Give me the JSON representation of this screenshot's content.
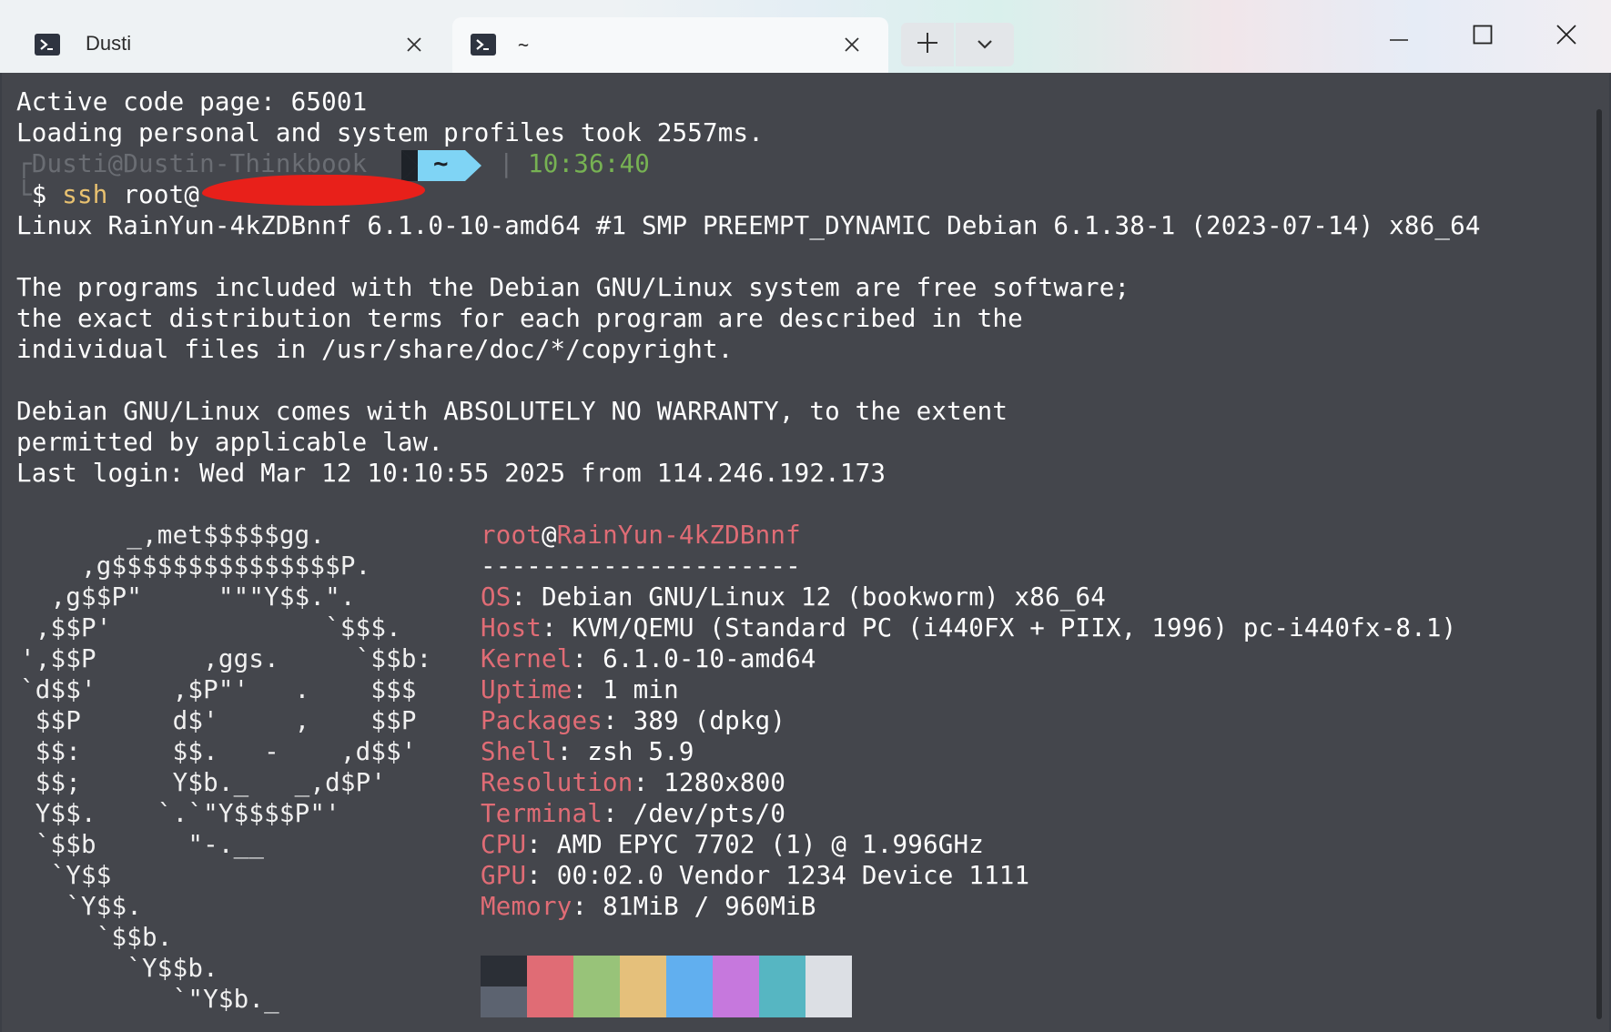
{
  "window": {
    "tabs": [
      {
        "label": "Dusti",
        "icon": "powershell-icon"
      },
      {
        "label": "~",
        "icon": "powershell-icon"
      }
    ],
    "new_tab_icon": "plus-icon",
    "dropdown_icon": "chevron-down-icon",
    "controls": [
      "minimize-icon",
      "maximize-icon",
      "close-icon"
    ]
  },
  "terminal": {
    "line1": "Active code page: 65001",
    "line2": "Loading personal and system profiles took 2557ms.",
    "prompt": {
      "user_host": "Dusti@Dustin-Thinkbook",
      "dir": "~",
      "separator": "|",
      "time": "10:36:40",
      "dollar": "$",
      "cmd": "ssh",
      "arg": "root@"
    },
    "motd": [
      "Linux RainYun-4kZDBnnf 6.1.0-10-amd64 #1 SMP PREEMPT_DYNAMIC Debian 6.1.38-1 (2023-07-14) x86_64",
      "",
      "The programs included with the Debian GNU/Linux system are free software;",
      "the exact distribution terms for each program are described in the",
      "individual files in /usr/share/doc/*/copyright.",
      "",
      "Debian GNU/Linux comes with ABSOLUTELY NO WARRANTY, to the extent",
      "permitted by applicable law.",
      "Last login: Wed Mar 12 10:10:55 2025 from 114.246.192.173"
    ],
    "logo": [
      "       _,met$$$$$gg.",
      "    ,g$$$$$$$$$$$$$$$P.",
      "  ,g$$P\"     \"\"\"Y$$.\".",
      " ,$$P'              `$$$.",
      "',$$P       ,ggs.     `$$b:",
      "`d$$'     ,$P\"'   .    $$$",
      " $$P      d$'     ,    $$P",
      " $$:      $$.   -    ,d$$'",
      " $$;      Y$b._   _,d$P'",
      " Y$$.    `.`\"Y$$$$P\"'",
      " `$$b      \"-.__",
      "  `Y$$",
      "   `Y$$.",
      "     `$$b.",
      "       `Y$$b.",
      "          `\"Y$b._"
    ],
    "fetch": {
      "user": "root",
      "at": "@",
      "host": "RainYun-4kZDBnnf",
      "rule": "---------------------",
      "rows": [
        {
          "key": "OS",
          "value": "Debian GNU/Linux 12 (bookworm) x86_64"
        },
        {
          "key": "Host",
          "value": "KVM/QEMU (Standard PC (i440FX + PIIX, 1996) pc-i440fx-8.1)"
        },
        {
          "key": "Kernel",
          "value": "6.1.0-10-amd64"
        },
        {
          "key": "Uptime",
          "value": "1 min"
        },
        {
          "key": "Packages",
          "value": "389 (dpkg)"
        },
        {
          "key": "Shell",
          "value": "zsh 5.9"
        },
        {
          "key": "Resolution",
          "value": "1280x800"
        },
        {
          "key": "Terminal",
          "value": "/dev/pts/0"
        },
        {
          "key": "CPU",
          "value": "AMD EPYC 7702 (1) @ 1.996GHz"
        },
        {
          "key": "GPU",
          "value": "00:02.0 Vendor 1234 Device 1111"
        },
        {
          "key": "Memory",
          "value": "81MiB / 960MiB"
        }
      ],
      "palette_top": [
        "#2b2f36",
        "#e06c75",
        "#98c379",
        "#e5c07b",
        "#61afef",
        "#c678dd",
        "#56b6c2",
        "#dcdfe4"
      ],
      "palette_bottom": [
        "#5c6370",
        "#e06c75",
        "#98c379",
        "#e5c07b",
        "#61afef",
        "#c678dd",
        "#56b6c2",
        "#dcdfe4"
      ]
    }
  }
}
